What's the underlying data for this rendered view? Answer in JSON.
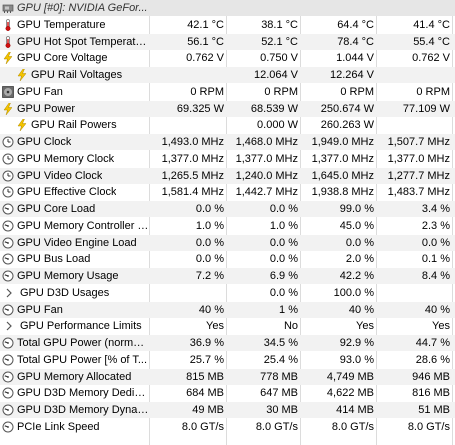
{
  "rows": [
    {
      "label": "GPU [#0]: NVIDIA GeFor...",
      "icon": "gpu-icon",
      "kind": "header",
      "values": [
        "",
        "",
        "",
        ""
      ]
    },
    {
      "label": "GPU Temperature",
      "icon": "thermometer-icon",
      "kind": "sensor",
      "values": [
        "42.1 °C",
        "38.1 °C",
        "64.4 °C",
        "41.4 °C"
      ]
    },
    {
      "label": "GPU Hot Spot Temperature",
      "icon": "thermometer-icon",
      "kind": "sensor",
      "values": [
        "56.1 °C",
        "52.1 °C",
        "78.4 °C",
        "55.4 °C"
      ]
    },
    {
      "label": "GPU Core Voltage",
      "icon": "lightning-icon",
      "kind": "sensor",
      "values": [
        "0.762 V",
        "0.750 V",
        "1.044 V",
        "0.762 V"
      ]
    },
    {
      "label": "GPU Rail Voltages",
      "icon": "lightning-icon",
      "kind": "group",
      "values": [
        "",
        "12.064 V",
        "12.264 V",
        ""
      ]
    },
    {
      "label": "GPU Fan",
      "icon": "fan-icon",
      "kind": "sensor",
      "values": [
        "0 RPM",
        "0 RPM",
        "0 RPM",
        "0 RPM"
      ]
    },
    {
      "label": "GPU Power",
      "icon": "lightning-icon",
      "kind": "sensor",
      "values": [
        "69.325 W",
        "68.539 W",
        "250.674 W",
        "77.109 W"
      ]
    },
    {
      "label": "GPU Rail Powers",
      "icon": "lightning-icon",
      "kind": "group",
      "values": [
        "",
        "0.000 W",
        "260.263 W",
        ""
      ]
    },
    {
      "label": "GPU Clock",
      "icon": "clock-icon",
      "kind": "sensor",
      "values": [
        "1,493.0 MHz",
        "1,468.0 MHz",
        "1,949.0 MHz",
        "1,507.7 MHz"
      ]
    },
    {
      "label": "GPU Memory Clock",
      "icon": "clock-icon",
      "kind": "sensor",
      "values": [
        "1,377.0 MHz",
        "1,377.0 MHz",
        "1,377.0 MHz",
        "1,377.0 MHz"
      ]
    },
    {
      "label": "GPU Video Clock",
      "icon": "clock-icon",
      "kind": "sensor",
      "values": [
        "1,265.5 MHz",
        "1,240.0 MHz",
        "1,645.0 MHz",
        "1,277.7 MHz"
      ]
    },
    {
      "label": "GPU Effective Clock",
      "icon": "clock-icon",
      "kind": "sensor",
      "values": [
        "1,581.4 MHz",
        "1,442.7 MHz",
        "1,938.8 MHz",
        "1,483.7 MHz"
      ]
    },
    {
      "label": "GPU Core Load",
      "icon": "gauge-icon",
      "kind": "sensor",
      "values": [
        "0.0 %",
        "0.0 %",
        "99.0 %",
        "3.4 %"
      ]
    },
    {
      "label": "GPU Memory Controller L...",
      "icon": "gauge-icon",
      "kind": "sensor",
      "values": [
        "1.0 %",
        "1.0 %",
        "45.0 %",
        "2.3 %"
      ]
    },
    {
      "label": "GPU Video Engine Load",
      "icon": "gauge-icon",
      "kind": "sensor",
      "values": [
        "0.0 %",
        "0.0 %",
        "0.0 %",
        "0.0 %"
      ]
    },
    {
      "label": "GPU Bus Load",
      "icon": "gauge-icon",
      "kind": "sensor",
      "values": [
        "0.0 %",
        "0.0 %",
        "2.0 %",
        "0.1 %"
      ]
    },
    {
      "label": "GPU Memory Usage",
      "icon": "gauge-icon",
      "kind": "sensor",
      "values": [
        "7.2 %",
        "6.9 %",
        "42.2 %",
        "8.4 %"
      ]
    },
    {
      "label": "GPU D3D Usages",
      "icon": "chevron-right-icon",
      "kind": "group",
      "values": [
        "",
        "0.0 %",
        "100.0 %",
        ""
      ]
    },
    {
      "label": "GPU Fan",
      "icon": "gauge-icon",
      "kind": "sensor",
      "values": [
        "40 %",
        "1 %",
        "40 %",
        "40 %"
      ]
    },
    {
      "label": "GPU Performance Limits",
      "icon": "chevron-right-icon",
      "kind": "group",
      "values": [
        "Yes",
        "No",
        "Yes",
        "Yes"
      ]
    },
    {
      "label": "Total GPU Power (normali...",
      "icon": "gauge-icon",
      "kind": "sensor",
      "values": [
        "36.9 %",
        "34.5 %",
        "92.9 %",
        "44.7 %"
      ]
    },
    {
      "label": "Total GPU Power [% of T...",
      "icon": "gauge-icon",
      "kind": "sensor",
      "values": [
        "25.7 %",
        "25.4 %",
        "93.0 %",
        "28.6 %"
      ]
    },
    {
      "label": "GPU Memory Allocated",
      "icon": "gauge-icon",
      "kind": "sensor",
      "values": [
        "815 MB",
        "778 MB",
        "4,749 MB",
        "946 MB"
      ]
    },
    {
      "label": "GPU D3D Memory Dedica...",
      "icon": "gauge-icon",
      "kind": "sensor",
      "values": [
        "684 MB",
        "647 MB",
        "4,622 MB",
        "816 MB"
      ]
    },
    {
      "label": "GPU D3D Memory Dynamic",
      "icon": "gauge-icon",
      "kind": "sensor",
      "values": [
        "49 MB",
        "30 MB",
        "414 MB",
        "51 MB"
      ]
    },
    {
      "label": "PCIe Link Speed",
      "icon": "gauge-icon",
      "kind": "sensor",
      "values": [
        "8.0 GT/s",
        "8.0 GT/s",
        "8.0 GT/s",
        "8.0 GT/s"
      ]
    }
  ]
}
